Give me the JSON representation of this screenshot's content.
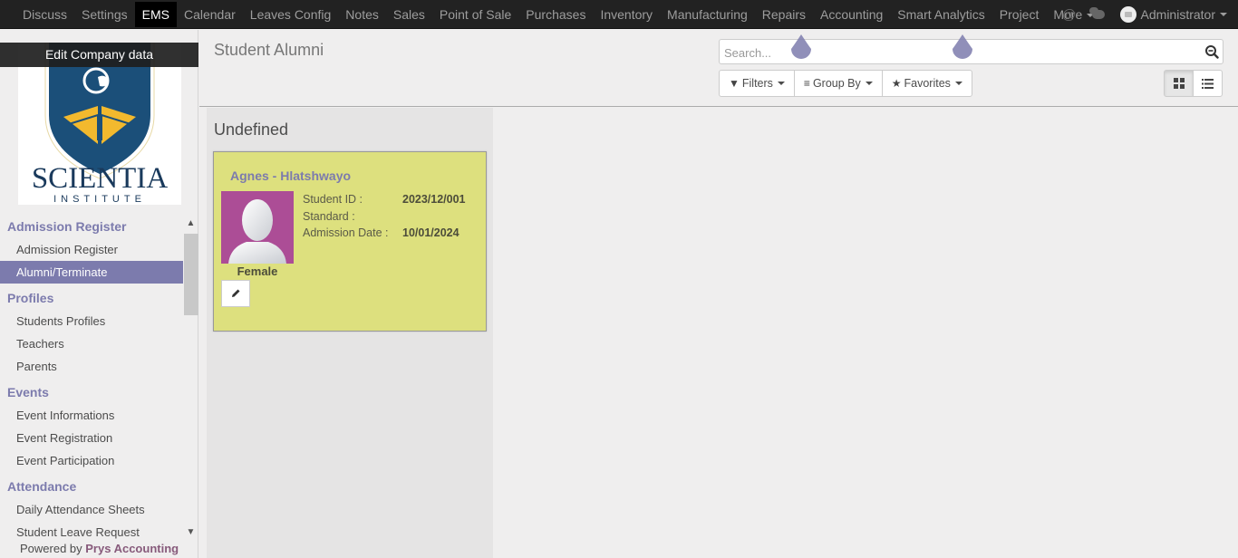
{
  "topbar": {
    "menu": [
      {
        "label": "Discuss",
        "active": false
      },
      {
        "label": "Settings",
        "active": false
      },
      {
        "label": "EMS",
        "active": true
      },
      {
        "label": "Calendar",
        "active": false
      },
      {
        "label": "Leaves Config",
        "active": false
      },
      {
        "label": "Notes",
        "active": false
      },
      {
        "label": "Sales",
        "active": false
      },
      {
        "label": "Point of Sale",
        "active": false
      },
      {
        "label": "Purchases",
        "active": false
      },
      {
        "label": "Inventory",
        "active": false
      },
      {
        "label": "Manufacturing",
        "active": false
      },
      {
        "label": "Repairs",
        "active": false
      },
      {
        "label": "Accounting",
        "active": false
      },
      {
        "label": "Smart Analytics",
        "active": false
      },
      {
        "label": "Project",
        "active": false
      }
    ],
    "more_label": "More",
    "mention_icon": "@",
    "user_name": "Administrator",
    "icons": {
      "mention": "at-icon",
      "chat": "chat-icon",
      "user": "avatar"
    }
  },
  "sidebar": {
    "edit_company_label": "Edit Company data",
    "logo": {
      "name": "SCIENTIA",
      "subtitle": "INSTITUTE"
    },
    "sections": [
      {
        "title": "Admission Register",
        "items": [
          {
            "label": "Admission Register",
            "active": false
          },
          {
            "label": "Alumni/Terminate",
            "active": true
          }
        ]
      },
      {
        "title": "Profiles",
        "items": [
          {
            "label": "Students Profiles",
            "active": false
          },
          {
            "label": "Teachers",
            "active": false
          },
          {
            "label": "Parents",
            "active": false
          }
        ]
      },
      {
        "title": "Events",
        "items": [
          {
            "label": "Event Informations",
            "active": false
          },
          {
            "label": "Event Registration",
            "active": false
          },
          {
            "label": "Event Participation",
            "active": false
          }
        ]
      },
      {
        "title": "Attendance",
        "items": [
          {
            "label": "Daily Attendance Sheets",
            "active": false
          },
          {
            "label": "Student Leave Request",
            "active": false
          }
        ]
      }
    ],
    "powered_prefix": "Powered by ",
    "powered_brand": "Prys Accounting"
  },
  "control_panel": {
    "title": "Student Alumni",
    "search": {
      "placeholder": "Search...",
      "value": ""
    },
    "filters_label": "Filters",
    "groupby_label": "Group By",
    "favorites_label": "Favorites",
    "views": [
      {
        "name": "kanban",
        "active": true
      },
      {
        "name": "list",
        "active": false
      }
    ]
  },
  "kanban": {
    "columns": [
      {
        "title": "Undefined",
        "cards": [
          {
            "name": "Agnes - Hlatshwayo",
            "gender": "Female",
            "fields": [
              {
                "label": "Student ID :",
                "value": "2023/12/001"
              },
              {
                "label": "Standard :",
                "value": ""
              },
              {
                "label": "Admission Date :",
                "value": "10/01/2024"
              }
            ]
          }
        ]
      }
    ]
  },
  "colors": {
    "accent": "#7c7bad",
    "topbar_bg": "#222222",
    "card_bg": "#dde07e",
    "avatar_bg": "#ac4d96",
    "powered_brand": "#875a7b"
  }
}
